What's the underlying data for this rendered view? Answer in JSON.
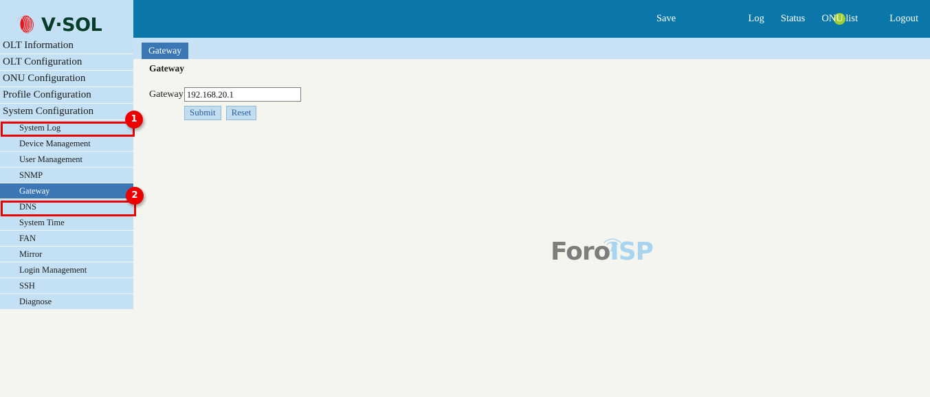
{
  "brand": {
    "logo_text": "V·SOL",
    "logo_mark_color": "#e8141e",
    "logo_text_color": "#063d28"
  },
  "header": {
    "save_label": "Save",
    "status_indicator": {
      "name": "status-dot",
      "color": "#9fcd33"
    },
    "links": [
      {
        "label": "Log"
      },
      {
        "label": "Status"
      },
      {
        "label": "ONU list"
      },
      {
        "label": "Logout"
      }
    ],
    "background_color": "#0b76a8"
  },
  "tabs": [
    {
      "label": "Gateway",
      "active": true
    }
  ],
  "sidebar": {
    "menu": [
      {
        "label": "OLT Information",
        "type": "top",
        "selected": false
      },
      {
        "label": "OLT Configuration",
        "type": "top",
        "selected": false
      },
      {
        "label": "ONU Configuration",
        "type": "top",
        "selected": false
      },
      {
        "label": "Profile Configuration",
        "type": "top",
        "selected": false
      },
      {
        "label": "System Configuration",
        "type": "top",
        "selected": false
      },
      {
        "label": "System Log",
        "type": "sub",
        "selected": false
      },
      {
        "label": "Device Management",
        "type": "sub",
        "selected": false
      },
      {
        "label": "User Management",
        "type": "sub",
        "selected": false
      },
      {
        "label": "SNMP",
        "type": "sub",
        "selected": false
      },
      {
        "label": "Gateway",
        "type": "sub",
        "selected": true
      },
      {
        "label": "DNS",
        "type": "sub",
        "selected": false
      },
      {
        "label": "System Time",
        "type": "sub",
        "selected": false
      },
      {
        "label": "FAN",
        "type": "sub",
        "selected": false
      },
      {
        "label": "Mirror",
        "type": "sub",
        "selected": false
      },
      {
        "label": "Login Management",
        "type": "sub",
        "selected": false
      },
      {
        "label": "SSH",
        "type": "sub",
        "selected": false
      },
      {
        "label": "Diagnose",
        "type": "sub",
        "selected": false
      }
    ],
    "item_background": "#c3e0f4",
    "selected_background": "#3c77b5"
  },
  "main": {
    "section_title": "Gateway",
    "form": {
      "label": "Gateway",
      "value": "192.168.20.1",
      "placeholder": ""
    },
    "buttons": {
      "submit": "Submit",
      "reset": "Reset"
    }
  },
  "watermark": {
    "part1": "Foro",
    "part2": "ISP",
    "part1_color": "#7d7d7d",
    "part2_color": "#a8d4ef"
  },
  "annotations": [
    {
      "badge": "1",
      "target": "System Configuration"
    },
    {
      "badge": "2",
      "target": "Gateway"
    }
  ]
}
